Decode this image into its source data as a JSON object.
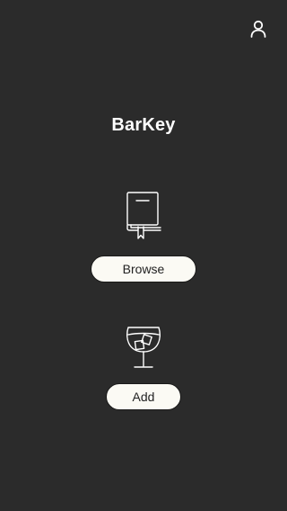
{
  "app": {
    "title": "BarKey"
  },
  "header": {
    "profile_icon": "user-icon"
  },
  "actions": {
    "browse": {
      "icon": "book-icon",
      "label": "Browse"
    },
    "add": {
      "icon": "wine-glass-ice-icon",
      "label": "Add"
    }
  },
  "colors": {
    "background": "#2b2b2b",
    "button_fill": "#fbfaf4",
    "text_light": "#ffffff",
    "text_dark": "#222222"
  }
}
